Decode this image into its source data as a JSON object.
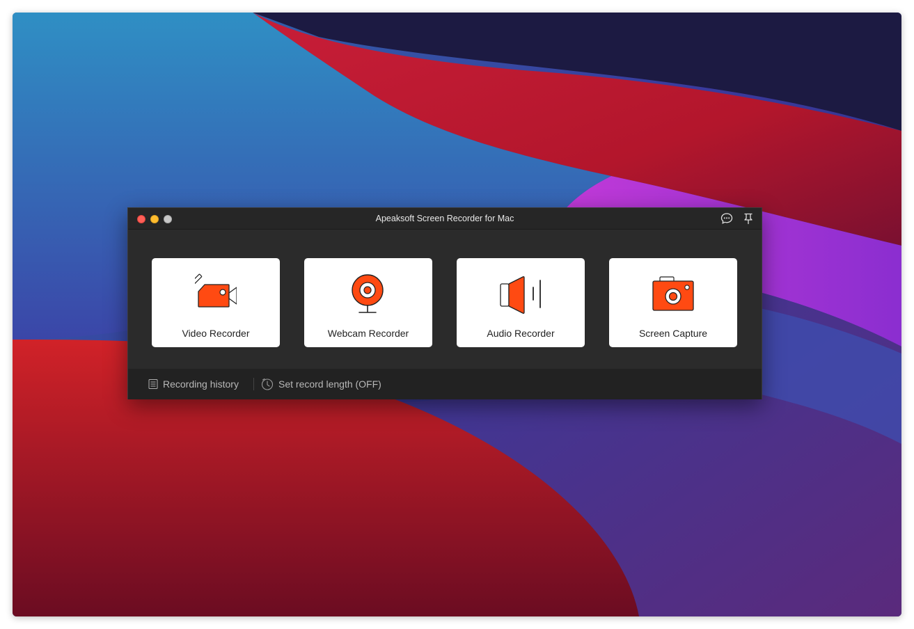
{
  "window": {
    "title": "Apeaksoft Screen Recorder for Mac",
    "controls": [
      "close",
      "minimize",
      "zoom"
    ],
    "toolbar_icons": [
      "feedback-icon",
      "pin-icon"
    ]
  },
  "modes": [
    {
      "label": "Video Recorder",
      "icon": "video-camera-icon"
    },
    {
      "label": "Webcam Recorder",
      "icon": "webcam-icon"
    },
    {
      "label": "Audio Recorder",
      "icon": "speaker-icon"
    },
    {
      "label": "Screen Capture",
      "icon": "camera-icon"
    }
  ],
  "footer": {
    "history_label": "Recording history",
    "record_length_label": "Set record length (OFF)"
  },
  "colors": {
    "accent": "#ff4a12",
    "window_bg": "#2b2b2b",
    "card_bg": "#ffffff"
  }
}
